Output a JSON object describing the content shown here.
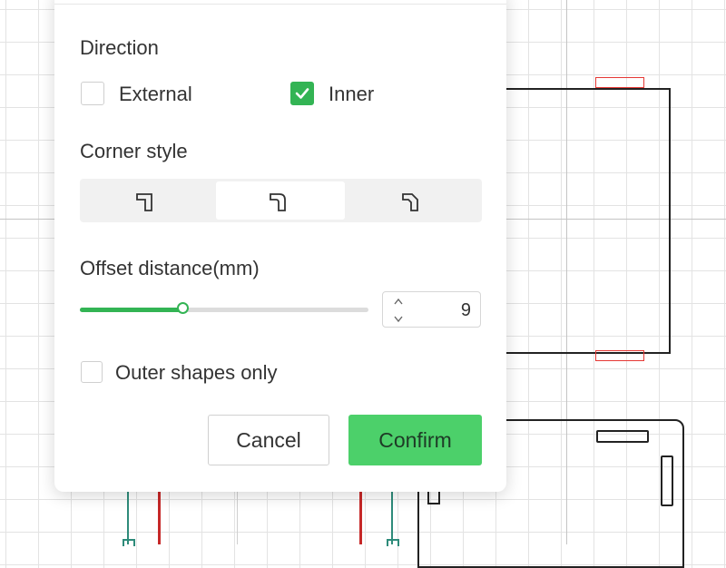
{
  "dialog": {
    "direction": {
      "heading": "Direction",
      "options": [
        {
          "label": "External",
          "checked": false
        },
        {
          "label": "Inner",
          "checked": true
        }
      ]
    },
    "corner_style": {
      "heading": "Corner style",
      "options": [
        {
          "icon": "square-corner-icon",
          "active": false
        },
        {
          "icon": "round-corner-icon",
          "active": true
        },
        {
          "icon": "chamfer-corner-icon",
          "active": false
        }
      ]
    },
    "offset": {
      "heading": "Offset distance(mm)",
      "slider_fraction": 0.36,
      "value": "9"
    },
    "outer_only": {
      "label": "Outer shapes only",
      "checked": false
    },
    "buttons": {
      "cancel": "Cancel",
      "confirm": "Confirm"
    }
  },
  "colors": {
    "accent": "#33b454",
    "confirm_bg": "#4cd06a",
    "outline_red": "#e53935"
  }
}
